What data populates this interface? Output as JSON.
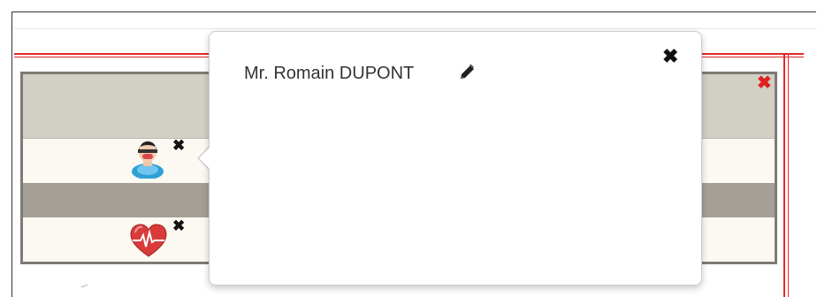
{
  "popover": {
    "title": "Mr. Romain DUPONT",
    "edit_icon": "pencil-icon",
    "close_icon": "close-icon"
  },
  "panel": {
    "close_icon": "close-icon",
    "items": [
      {
        "icon": "patient-avatar-icon",
        "close_icon": "close-icon"
      },
      {
        "icon": "heart-monitor-icon",
        "close_icon": "close-icon"
      }
    ]
  },
  "glyphs": {
    "close": "✖",
    "panel_close": "✖"
  },
  "colors": {
    "accent_red": "#e02a2a",
    "grid_border": "#7f7a75",
    "row_header": "#d2cfc5",
    "row_dark": "#a59f97",
    "row_light": "#fbf9f1"
  }
}
